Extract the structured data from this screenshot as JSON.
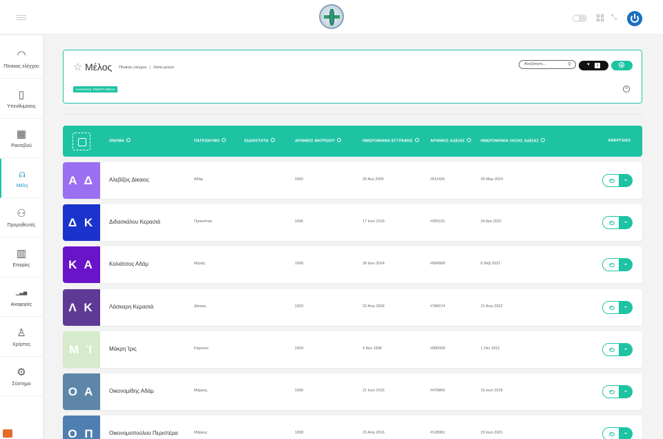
{
  "sidebar": {
    "items": [
      {
        "label": "Πίνακας ελέγχου",
        "icon": "gauge-icon"
      },
      {
        "label": "Υπενθυμίσεις",
        "icon": "document-icon"
      },
      {
        "label": "Ραντεβού",
        "icon": "calendar-icon"
      },
      {
        "label": "Μέλη",
        "icon": "user-icon"
      },
      {
        "label": "Προμηθευτές",
        "icon": "users-icon"
      },
      {
        "label": "Εταιρίες",
        "icon": "building-icon"
      },
      {
        "label": "Αναφορές",
        "icon": "bar-chart-icon"
      },
      {
        "label": "Χρήστες",
        "icon": "user-group-icon"
      },
      {
        "label": "Σύστημα",
        "icon": "gear-icon"
      }
    ],
    "active_index": 3
  },
  "header": {
    "title": "Μέλος",
    "breadcrumb": [
      "Πίνακας ελέγχου",
      "Λίστα μελών"
    ],
    "search_placeholder": "Αναζήτηση...",
    "filter_count": "1",
    "status_tag": "Κατάσταση: ΕΝΕΡΓΑ ΜΕΛΗ"
  },
  "table": {
    "columns": [
      "ΟΝΟΜΑ",
      "ΠΑΤΡΩΝΥΜΟ",
      "ΕΙΔΙΚΟΤΗΤΑ",
      "ΑΡΙΘΜΟΣ ΜΗΤΡΩΟΥ",
      "ΗΜΕΡΟΜΗΝΙΑ ΕΓΓΡΑΦΗΣ",
      "ΑΡΙΘΜΟΣ ΑΔΕΙΑΣ",
      "ΗΜΕΡΟΜΗΝΙΑ ΛΗΞΗΣ ΑΔΕΙΑΣ",
      "ΕΝΕΡΓΕΙΕΣ"
    ],
    "rows": [
      {
        "initials": "Α Δ",
        "color": "#9b6ff2",
        "name": "Αλεβίζος Δίκαιος",
        "father": "Αδάμ",
        "specialty": "",
        "registry": "1002",
        "reg_date": "26 Αυγ 2005",
        "license": "#011426",
        "expiry": "20 Μαρ 2024"
      },
      {
        "initials": "Δ Κ",
        "color": "#1a33cc",
        "name": "Διδασκάλου Κερασιά",
        "father": "Προκόπιος",
        "specialty": "",
        "registry": "1006",
        "reg_date": "17 Ιουλ 2016",
        "license": "#355191",
        "expiry": "24 Δεκ 2022"
      },
      {
        "initials": "Κ Α",
        "color": "#6a14c9",
        "name": "Κολιάτσος Αδάμ",
        "father": "Μηνάς",
        "specialty": "",
        "registry": "1009",
        "reg_date": "28 Ιουν 2024",
        "license": "#084589",
        "expiry": "8 Φεβ 2023"
      },
      {
        "initials": "Λ Κ",
        "color": "#5e3a96",
        "name": "Λάσκαρη Κερασιά",
        "father": "Δίκαιος",
        "specialty": "",
        "registry": "1003",
        "reg_date": "22 Απρ 2009",
        "license": "#786574",
        "expiry": "21 Απρ 2022"
      },
      {
        "initials": "Μ Ί",
        "color": "#d5ebcb",
        "name": "Μάκρη Ίρις",
        "father": "Κάρολος",
        "specialty": "",
        "registry": "1004",
        "reg_date": "4 Νοε 1996",
        "license": "#080008",
        "expiry": "1 Οκτ 2021"
      },
      {
        "initials": "Ο Α",
        "color": "#5e86a8",
        "name": "Οικονομίδης Αδάμ",
        "father": "Μάρκος",
        "specialty": "",
        "registry": "1000",
        "reg_date": "21 Ιουλ 2016",
        "license": "#478866",
        "expiry": "15 Ιουλ 2018"
      },
      {
        "initials": "Ο Π",
        "color": "#4f7fb0",
        "name": "Οικονομοπούλου Περιστέρα",
        "father": "Μάρκος",
        "specialty": "",
        "registry": "1008",
        "reg_date": "15 Απρ 2016",
        "license": "#128081",
        "expiry": "23 Ιουλ 2021"
      }
    ]
  },
  "colors": {
    "accent": "#1ec3a3",
    "power": "#1a6fc0"
  }
}
